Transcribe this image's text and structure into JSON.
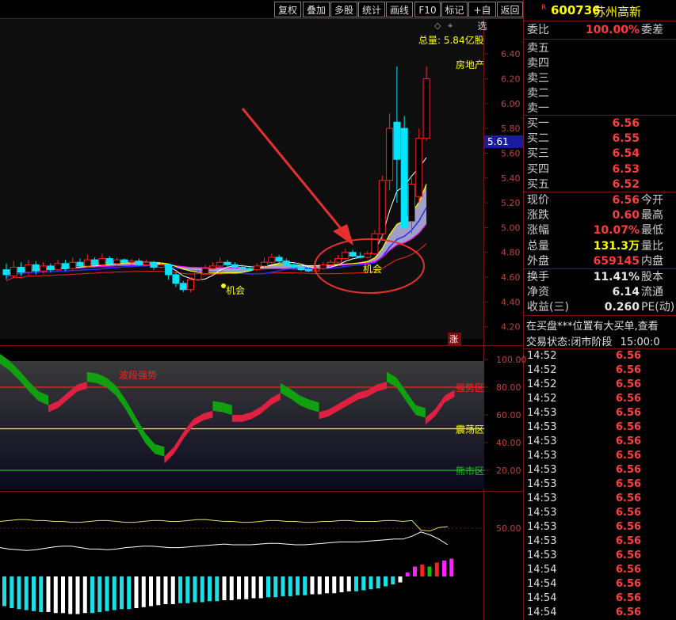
{
  "toolbar": {
    "buttons": [
      "复权",
      "叠加",
      "多股",
      "统计",
      "画线",
      "F10",
      "标记",
      "+自选",
      "返回"
    ]
  },
  "quote": {
    "badge": "R",
    "code": "600736",
    "name": "苏州高新",
    "weibi_label": "委比",
    "weibi_value": "100.00%",
    "weicha_label": "委差",
    "sells": [
      "卖五",
      "卖四",
      "卖三",
      "卖二",
      "卖一"
    ],
    "buys": [
      {
        "label": "买一",
        "price": "6.56"
      },
      {
        "label": "买二",
        "price": "6.55"
      },
      {
        "label": "买三",
        "price": "6.54"
      },
      {
        "label": "买四",
        "price": "6.53"
      },
      {
        "label": "买五",
        "price": "6.52"
      }
    ],
    "stats": [
      {
        "k": "现价",
        "v": "6.56",
        "k2": "今开",
        "cls": "red"
      },
      {
        "k": "涨跌",
        "v": "0.60",
        "k2": "最高",
        "cls": "red"
      },
      {
        "k": "涨幅",
        "v": "10.07%",
        "k2": "最低",
        "cls": "red"
      },
      {
        "k": "总量",
        "v": "131.3万",
        "k2": "量比",
        "cls": "yel"
      },
      {
        "k": "外盘",
        "v": "659145",
        "k2": "内盘",
        "cls": "red"
      }
    ],
    "stats2": [
      {
        "k": "换手",
        "v": "11.41%",
        "k2": "股本",
        "cls": "wht"
      },
      {
        "k": "净资",
        "v": "6.14",
        "k2": "流通",
        "cls": "wht"
      },
      {
        "k": "收益(三)",
        "v": "0.260",
        "k2": "PE(动)",
        "cls": "wht"
      }
    ],
    "notice": "在买盘***位置有大买单,查看",
    "status_label": "交易状态:",
    "status_value": "闭市阶段",
    "status_time": "15:00:0"
  },
  "ticks": [
    {
      "time": "14:52",
      "price": "6.56"
    },
    {
      "time": "14:52",
      "price": "6.56"
    },
    {
      "time": "14:52",
      "price": "6.56"
    },
    {
      "time": "14:52",
      "price": "6.56"
    },
    {
      "time": "14:53",
      "price": "6.56"
    },
    {
      "time": "14:53",
      "price": "6.56"
    },
    {
      "time": "14:53",
      "price": "6.56"
    },
    {
      "time": "14:53",
      "price": "6.56"
    },
    {
      "time": "14:53",
      "price": "6.56"
    },
    {
      "time": "14:53",
      "price": "6.56"
    },
    {
      "time": "14:53",
      "price": "6.56"
    },
    {
      "time": "14:53",
      "price": "6.56"
    },
    {
      "time": "14:53",
      "price": "6.56"
    },
    {
      "time": "14:53",
      "price": "6.56"
    },
    {
      "time": "14:53",
      "price": "6.56"
    },
    {
      "time": "14:54",
      "price": "6.56"
    },
    {
      "time": "14:54",
      "price": "6.56"
    },
    {
      "time": "14:54",
      "price": "6.56"
    },
    {
      "time": "14:54",
      "price": "6.56"
    }
  ],
  "colors": {
    "up": "#ff2020",
    "down": "#00e5ff",
    "ma5": "#ffffff",
    "ma10": "#ffff00",
    "ma20": "#ff00ff",
    "ma60": "#2a2aff",
    "ma120": "#ff2020",
    "wave_up": "#e02040",
    "wave_down": "#10a010"
  },
  "chart_data": [
    {
      "type": "candlestick",
      "panel": "main",
      "total_volume_text": "总量: 5.84亿股",
      "sector_label": "房地产",
      "price_marker": "5.61",
      "annotations": [
        "机会",
        "机会"
      ],
      "bottom_tag": "涨",
      "y_ticks": [
        4.2,
        4.4,
        4.6,
        4.8,
        5.0,
        5.2,
        5.4,
        5.6,
        5.8,
        6.0,
        6.2,
        6.4
      ],
      "ylim": [
        4.08,
        6.62
      ],
      "candles": [
        [
          4.66,
          4.62,
          4.71,
          4.58
        ],
        [
          4.61,
          4.68,
          4.73,
          4.59
        ],
        [
          4.68,
          4.64,
          4.72,
          4.61
        ],
        [
          4.64,
          4.7,
          4.74,
          4.62
        ],
        [
          4.7,
          4.65,
          4.73,
          4.62
        ],
        [
          4.65,
          4.69,
          4.72,
          4.63
        ],
        [
          4.69,
          4.66,
          4.71,
          4.64
        ],
        [
          4.66,
          4.71,
          4.74,
          4.65
        ],
        [
          4.71,
          4.67,
          4.74,
          4.65
        ],
        [
          4.67,
          4.72,
          4.76,
          4.66
        ],
        [
          4.72,
          4.69,
          4.75,
          4.67
        ],
        [
          4.69,
          4.74,
          4.78,
          4.68
        ],
        [
          4.74,
          4.7,
          4.76,
          4.68
        ],
        [
          4.7,
          4.75,
          4.79,
          4.69
        ],
        [
          4.75,
          4.71,
          4.77,
          4.69
        ],
        [
          4.71,
          4.74,
          4.76,
          4.69
        ],
        [
          4.74,
          4.72,
          4.75,
          4.7
        ],
        [
          4.72,
          4.73,
          4.75,
          4.7
        ],
        [
          4.73,
          4.7,
          4.75,
          4.69
        ],
        [
          4.7,
          4.72,
          4.74,
          4.69
        ],
        [
          4.72,
          4.68,
          4.73,
          4.66
        ],
        [
          4.68,
          4.7,
          4.72,
          4.67
        ],
        [
          4.7,
          4.62,
          4.71,
          4.58
        ],
        [
          4.62,
          4.55,
          4.64,
          4.52
        ],
        [
          4.55,
          4.5,
          4.57,
          4.48
        ],
        [
          4.5,
          4.58,
          4.6,
          4.48
        ],
        [
          4.58,
          4.63,
          4.66,
          4.57
        ],
        [
          4.63,
          4.67,
          4.7,
          4.62
        ],
        [
          4.67,
          4.69,
          4.72,
          4.66
        ],
        [
          4.69,
          4.72,
          4.76,
          4.68
        ],
        [
          4.72,
          4.7,
          4.74,
          4.68
        ],
        [
          4.7,
          4.68,
          4.72,
          4.66
        ],
        [
          4.68,
          4.67,
          4.7,
          4.66
        ],
        [
          4.67,
          4.66,
          4.69,
          4.65
        ],
        [
          4.66,
          4.69,
          4.71,
          4.65
        ],
        [
          4.69,
          4.72,
          4.76,
          4.68
        ],
        [
          4.72,
          4.76,
          4.79,
          4.71
        ],
        [
          4.76,
          4.73,
          4.78,
          4.71
        ],
        [
          4.73,
          4.7,
          4.75,
          4.69
        ],
        [
          4.7,
          4.68,
          4.72,
          4.67
        ],
        [
          4.68,
          4.66,
          4.7,
          4.65
        ],
        [
          4.66,
          4.65,
          4.68,
          4.64
        ],
        [
          4.65,
          4.67,
          4.69,
          4.64
        ],
        [
          4.67,
          4.7,
          4.72,
          4.66
        ],
        [
          4.7,
          4.72,
          4.74,
          4.69
        ],
        [
          4.72,
          4.75,
          4.78,
          4.71
        ],
        [
          4.75,
          4.8,
          4.83,
          4.74
        ],
        [
          4.8,
          4.77,
          4.82,
          4.76
        ],
        [
          4.77,
          4.76,
          4.8,
          4.75
        ],
        [
          4.76,
          4.79,
          4.81,
          4.75
        ],
        [
          4.79,
          4.95,
          4.98,
          4.78
        ],
        [
          4.95,
          5.38,
          5.42,
          4.9
        ],
        [
          5.38,
          5.8,
          5.92,
          5.3
        ],
        [
          5.85,
          5.55,
          6.3,
          5.2
        ],
        [
          5.8,
          5.0,
          5.9,
          4.98
        ],
        [
          5.05,
          5.35,
          5.4,
          4.95
        ],
        [
          5.25,
          5.72,
          5.8,
          5.2
        ],
        [
          5.72,
          6.2,
          6.3,
          5.7
        ]
      ]
    },
    {
      "type": "area",
      "panel": "oscillator",
      "y_ticks": [
        20,
        40,
        60,
        80,
        100
      ],
      "ylim": [
        0,
        100
      ],
      "zones": [
        {
          "label": "强势区",
          "value": 80
        },
        {
          "label": "震荡区",
          "value": 50
        },
        {
          "label": "熊市区",
          "value": 20
        }
      ],
      "annotation": "波段强势",
      "series": [
        {
          "values": [
            97,
            92,
            85,
            77,
            70,
            67,
            70,
            76,
            82,
            84,
            83,
            80,
            74,
            64,
            52,
            40,
            32,
            30,
            37,
            48,
            57,
            61,
            63,
            62,
            60,
            60,
            62,
            66,
            72,
            76,
            72,
            67,
            64,
            62,
            64,
            68,
            72,
            76,
            78,
            82,
            84,
            80,
            70,
            60,
            58,
            64,
            74,
            78
          ]
        }
      ]
    },
    {
      "type": "bar",
      "panel": "macd",
      "y_ticks": [
        50
      ],
      "values": [
        -30,
        -32,
        -33,
        -34,
        -35,
        -36,
        -36,
        -37,
        -37,
        -38,
        -38,
        -37,
        -37,
        -36,
        -35,
        -34,
        -33,
        -33,
        -32,
        -31,
        -30,
        -29,
        -28,
        -28,
        -27,
        -27,
        -26,
        -26,
        -25,
        -25,
        -24,
        -24,
        -23,
        -23,
        -22,
        -22,
        -21,
        -21,
        -20,
        -20,
        -19,
        -19,
        -18,
        -18,
        -17,
        -17,
        -16,
        -15,
        -15,
        -14,
        -13,
        -12,
        -10,
        -8,
        -6,
        4,
        10,
        12,
        10,
        14,
        16,
        18
      ],
      "lines": [
        {
          "values": [
            55,
            56,
            57,
            57,
            56,
            56,
            55,
            55,
            54,
            54,
            55,
            56,
            56,
            55,
            54,
            54,
            55,
            56,
            56,
            55,
            55,
            56,
            57,
            57,
            56,
            55,
            55,
            54,
            54,
            55,
            56,
            56,
            55,
            55,
            54,
            54,
            55,
            55,
            56,
            56,
            55,
            55,
            55,
            56,
            56,
            55,
            56,
            45,
            44,
            48,
            49
          ]
        },
        {
          "values": [
            36,
            34,
            33,
            32,
            33,
            35,
            37,
            38,
            38,
            36,
            34,
            34,
            33,
            34,
            36,
            37,
            38,
            38,
            37,
            36,
            36,
            37,
            38,
            39,
            40,
            41,
            40,
            40,
            40,
            41,
            42,
            42,
            41,
            40,
            40,
            41,
            42,
            43,
            44,
            44,
            44,
            45,
            46,
            47,
            48,
            48,
            52,
            58,
            54,
            48,
            40
          ]
        }
      ]
    }
  ]
}
